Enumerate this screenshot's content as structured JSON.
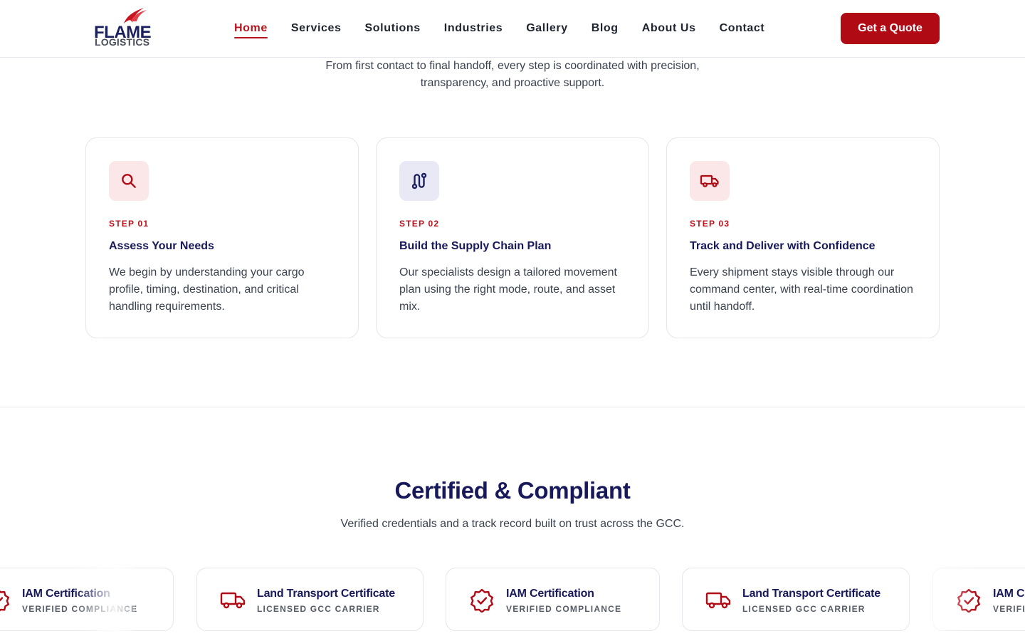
{
  "brand": {
    "name_line1": "FLAME",
    "name_line2": "LOGISTICS",
    "logo_icon": "flame-icon",
    "primary_color": "#b00a14",
    "navy_color": "#17195a"
  },
  "nav": {
    "items": [
      {
        "label": "Home",
        "active": true
      },
      {
        "label": "Services"
      },
      {
        "label": "Solutions"
      },
      {
        "label": "Industries"
      },
      {
        "label": "Gallery"
      },
      {
        "label": "Blog"
      },
      {
        "label": "About Us"
      },
      {
        "label": "Contact"
      }
    ],
    "cta_label": "Get a Quote"
  },
  "intro": {
    "line1": "From first contact to final handoff, every step is coordinated with precision,",
    "line2": "transparency, and proactive support."
  },
  "steps": [
    {
      "icon": "search-icon",
      "step": "STEP 01",
      "title": "Assess Your Needs",
      "description": "We begin by understanding your cargo profile, timing, destination, and critical handling requirements."
    },
    {
      "icon": "route-icon",
      "step": "STEP 02",
      "title": "Build the Supply Chain Plan",
      "description": "Our specialists design a tailored movement plan using the right mode, route, and asset mix."
    },
    {
      "icon": "truck-icon",
      "step": "STEP 03",
      "title": "Track and Deliver with Confidence",
      "description": "Every shipment stays visible through our command center, with real-time coordination until handoff."
    }
  ],
  "certified": {
    "title": "Certified & Compliant",
    "subtitle": "Verified credentials and a track record built on trust across the GCC."
  },
  "certificates": [
    {
      "icon": "badge-check-icon",
      "name": "IAM Certification",
      "tag": "VERIFIED COMPLIANCE"
    },
    {
      "icon": "truck-icon",
      "name": "Land Transport Certificate",
      "tag": "LICENSED GCC CARRIER"
    },
    {
      "icon": "badge-check-icon",
      "name": "IAM Certification",
      "tag": "VERIFIED COMPLIANCE"
    },
    {
      "icon": "truck-icon",
      "name": "Land Transport Certificate",
      "tag": "LICENSED GCC CARRIER"
    },
    {
      "icon": "badge-check-icon",
      "name": "IAM Certification",
      "tag": "VERIFIED COMPLIANCE"
    }
  ]
}
